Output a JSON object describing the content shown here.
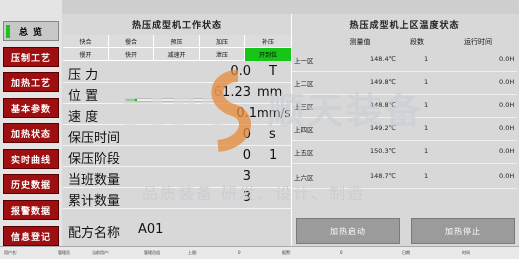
{
  "sidebar": {
    "items": [
      {
        "label": "总 览",
        "active": true
      },
      {
        "label": "压制工艺"
      },
      {
        "label": "加热工艺"
      },
      {
        "label": "基本参数"
      },
      {
        "label": "加热状态"
      },
      {
        "label": "实时曲线"
      },
      {
        "label": "历史数据"
      },
      {
        "label": "报警数据"
      },
      {
        "label": "信息登记"
      }
    ]
  },
  "machine_panel": {
    "title": "热压成型机工作状态",
    "steps_row1": [
      "快合",
      "慢合",
      "预压",
      "加压",
      "补压"
    ],
    "steps_row2": [
      "慢开",
      "快开",
      "减速开",
      "泄压",
      "开到位"
    ],
    "active_step": "开到位",
    "params": [
      {
        "label": "压  力",
        "value": "0.0",
        "unit": "T"
      },
      {
        "label": "位  置",
        "value": "61.23",
        "unit": "mm"
      },
      {
        "label": "速  度",
        "value": "0.1",
        "unit": "mm/s"
      },
      {
        "label": "保压时间",
        "value": "0",
        "unit": "s"
      },
      {
        "label": "保压阶段",
        "value": "0",
        "unit2": "1"
      },
      {
        "label": "当班数量",
        "value": "3"
      },
      {
        "label": "累计数量",
        "value": "3"
      },
      {
        "label": "配方名称",
        "value": "A01"
      }
    ],
    "position_fill": 0.12
  },
  "temp_panel": {
    "title": "热压成型机上区温度状态",
    "headers": [
      "测量值",
      "段数",
      "运行时间"
    ],
    "rows": [
      {
        "zone": "上一区",
        "value": "148.4℃",
        "segment": "1",
        "runtime": "0.0H"
      },
      {
        "zone": "上二区",
        "value": "149.8℃",
        "segment": "1",
        "runtime": "0.0H"
      },
      {
        "zone": "上三区",
        "value": "148.8℃",
        "segment": "1",
        "runtime": "0.0H"
      },
      {
        "zone": "上四区",
        "value": "149.2℃",
        "segment": "1",
        "runtime": "0.0H"
      },
      {
        "zone": "上五区",
        "value": "150.3℃",
        "segment": "1",
        "runtime": "0.0H"
      },
      {
        "zone": "上六区",
        "value": "148.7℃",
        "segment": "1",
        "runtime": "0.0H"
      }
    ]
  },
  "actions": {
    "heat_start": "加热启动",
    "heat_stop": "加热停止"
  },
  "watermark": {
    "brand": "顺天装备",
    "slogan": "品质装备 研发、设计、制造"
  },
  "statusbar": [
    "用户名:",
    "管理员",
    "当前用户:",
    "管理员组",
    "上限:",
    "0",
    "报警:",
    "0",
    "日期",
    "时间"
  ],
  "colors": {
    "sidebar_button": "#9e0f12",
    "active_green": "#17c517",
    "action_button": "#9b9b9b"
  }
}
